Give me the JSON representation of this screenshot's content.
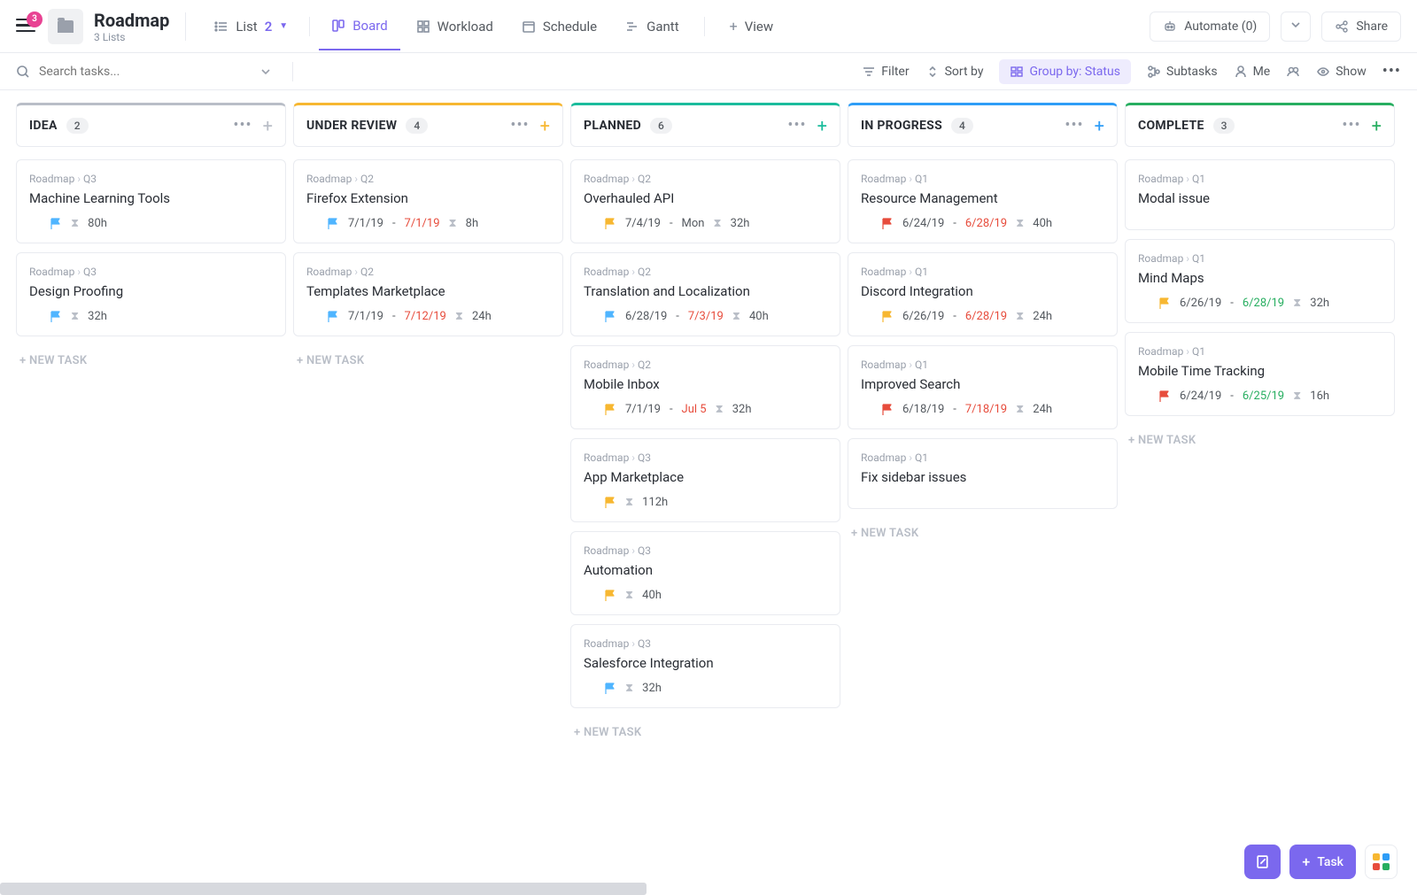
{
  "header": {
    "badge": "3",
    "title": "Roadmap",
    "subtitle": "3 Lists",
    "views": {
      "list": {
        "label": "List",
        "count": "2"
      },
      "board": {
        "label": "Board"
      },
      "workload": {
        "label": "Workload"
      },
      "schedule": {
        "label": "Schedule"
      },
      "gantt": {
        "label": "Gantt"
      },
      "add": {
        "label": "View"
      }
    },
    "automate": "Automate (0)",
    "share": "Share"
  },
  "toolbar": {
    "search_placeholder": "Search tasks...",
    "filter": "Filter",
    "sort": "Sort by",
    "group": "Group by: Status",
    "subtasks": "Subtasks",
    "me": "Me",
    "show": "Show"
  },
  "columns": [
    {
      "name": "IDEA",
      "count": "2",
      "color": "#b9bec7",
      "plus_color": "#b9bec7",
      "cards": [
        {
          "crumb": [
            "Roadmap",
            "Q3"
          ],
          "title": "Machine Learning Tools",
          "flag": "#4fb5ff",
          "duration": "80h"
        },
        {
          "crumb": [
            "Roadmap",
            "Q3"
          ],
          "title": "Design Proofing",
          "flag": "#4fb5ff",
          "duration": "32h"
        }
      ]
    },
    {
      "name": "UNDER REVIEW",
      "count": "4",
      "color": "#f7b731",
      "plus_color": "#f7b731",
      "cards": [
        {
          "crumb": [
            "Roadmap",
            "Q2"
          ],
          "title": "Firefox Extension",
          "flag": "#4fb5ff",
          "date1": "7/1/19",
          "dash": true,
          "date2": "7/1/19",
          "date2_class": "date-red",
          "duration": "8h"
        },
        {
          "crumb": [
            "Roadmap",
            "Q2"
          ],
          "title": "Templates Marketplace",
          "flag": "#4fb5ff",
          "date1": "7/1/19",
          "dash": true,
          "date2": "7/12/19",
          "date2_class": "date-red",
          "duration": "24h"
        }
      ]
    },
    {
      "name": "PLANNED",
      "count": "6",
      "color": "#1abc9c",
      "plus_color": "#1abc9c",
      "cards": [
        {
          "crumb": [
            "Roadmap",
            "Q2"
          ],
          "title": "Overhauled API",
          "flag": "#f7b731",
          "date1": "7/4/19",
          "dash": true,
          "date2": "Mon",
          "duration": "32h"
        },
        {
          "crumb": [
            "Roadmap",
            "Q2"
          ],
          "title": "Translation and Localization",
          "flag": "#4fb5ff",
          "date1": "6/28/19",
          "dash": true,
          "date2": "7/3/19",
          "date2_class": "date-red",
          "duration": "40h"
        },
        {
          "crumb": [
            "Roadmap",
            "Q2"
          ],
          "title": "Mobile Inbox",
          "flag": "#f7b731",
          "date1": "7/1/19",
          "dash": true,
          "date2": "Jul 5",
          "date2_class": "date-red",
          "duration": "32h"
        },
        {
          "crumb": [
            "Roadmap",
            "Q3"
          ],
          "title": "App Marketplace",
          "flag": "#f7b731",
          "duration": "112h"
        },
        {
          "crumb": [
            "Roadmap",
            "Q3"
          ],
          "title": "Automation",
          "flag": "#f7b731",
          "duration": "40h"
        },
        {
          "crumb": [
            "Roadmap",
            "Q3"
          ],
          "title": "Salesforce Integration",
          "flag": "#4fb5ff",
          "duration": "32h"
        }
      ]
    },
    {
      "name": "IN PROGRESS",
      "count": "4",
      "color": "#2e9df7",
      "plus_color": "#2e9df7",
      "cards": [
        {
          "crumb": [
            "Roadmap",
            "Q1"
          ],
          "title": "Resource Management",
          "flag": "#e74c3c",
          "date1": "6/24/19",
          "dash": true,
          "date2": "6/28/19",
          "date2_class": "date-red",
          "duration": "40h"
        },
        {
          "crumb": [
            "Roadmap",
            "Q1"
          ],
          "title": "Discord Integration",
          "flag": "#f7b731",
          "date1": "6/26/19",
          "dash": true,
          "date2": "6/28/19",
          "date2_class": "date-red",
          "duration": "24h"
        },
        {
          "crumb": [
            "Roadmap",
            "Q1"
          ],
          "title": "Improved Search",
          "flag": "#e74c3c",
          "date1": "6/18/19",
          "dash": true,
          "date2": "7/18/19",
          "date2_class": "date-red",
          "duration": "24h"
        },
        {
          "crumb": [
            "Roadmap",
            "Q1"
          ],
          "title": "Fix sidebar issues"
        }
      ]
    },
    {
      "name": "COMPLETE",
      "count": "3",
      "color": "#27ae60",
      "plus_color": "#27ae60",
      "cards": [
        {
          "crumb": [
            "Roadmap",
            "Q1"
          ],
          "title": "Modal issue"
        },
        {
          "crumb": [
            "Roadmap",
            "Q1"
          ],
          "title": "Mind Maps",
          "flag": "#f7b731",
          "date1": "6/26/19",
          "dash": true,
          "date2": "6/28/19",
          "date2_class": "date-green",
          "duration": "32h"
        },
        {
          "crumb": [
            "Roadmap",
            "Q1"
          ],
          "title": "Mobile Time Tracking",
          "flag": "#e74c3c",
          "date1": "6/24/19",
          "dash": true,
          "date2": "6/25/19",
          "date2_class": "date-green",
          "duration": "16h"
        }
      ]
    }
  ],
  "new_task_label": "+ NEW TASK",
  "task_btn": "Task"
}
